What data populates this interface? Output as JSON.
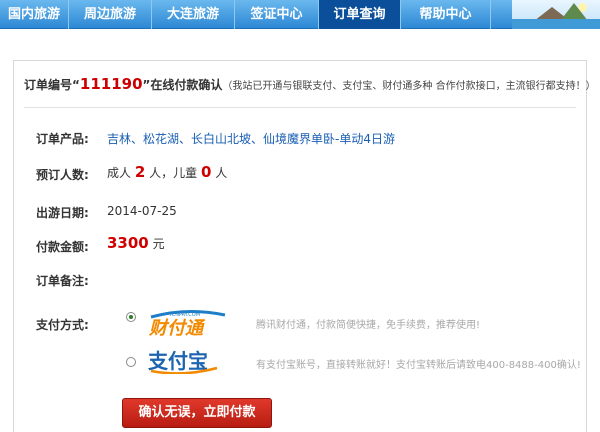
{
  "nav": {
    "items": [
      {
        "label": "国内旅游",
        "active": false
      },
      {
        "label": "周边旅游",
        "active": false
      },
      {
        "label": "大连旅游",
        "active": false
      },
      {
        "label": "签证中心",
        "active": false
      },
      {
        "label": "订单查询",
        "active": true
      },
      {
        "label": "帮助中心",
        "active": false
      }
    ]
  },
  "order": {
    "title_prefix": "订单编号“",
    "order_no": "111190",
    "title_suffix": "”在线付款确认",
    "title_note": "（我站已开通与银联支付、支付宝、财付通多种 合作付款接口，主流银行都支持！）",
    "product_label": "订单产品:",
    "product_value": "吉林、松花湖、长白山北坡、仙境魔界单卧-单动4日游",
    "people_label": "预订人数:",
    "adult_text": "成人",
    "adult_count": "2",
    "adult_unit": "人，儿童",
    "child_count": "0",
    "child_unit": "人",
    "date_label": "出游日期:",
    "date_value": "2014-07-25",
    "amount_label": "付款金额:",
    "amount_value": "3300",
    "amount_unit": "元",
    "remark_label": "订单备注:",
    "remark_value": ""
  },
  "payment": {
    "label": "支付方式:",
    "options": [
      {
        "name": "财付通",
        "site": "TENPAY.COM",
        "selected": true,
        "hint": "腾讯财付通，付款简便快捷，免手续费，推荐使用!"
      },
      {
        "name": "支付宝",
        "site": "",
        "selected": false,
        "hint": "有支付宝账号，直接转账就好！支付宝转账后请致电400-8488-400确认!"
      }
    ]
  },
  "confirm_label": "确认无误，立即付款",
  "colors": {
    "nav_active": "#0b4f9a",
    "price_red": "#d00000",
    "link_blue": "#1a5fb4",
    "button_red": "#c8261a"
  }
}
